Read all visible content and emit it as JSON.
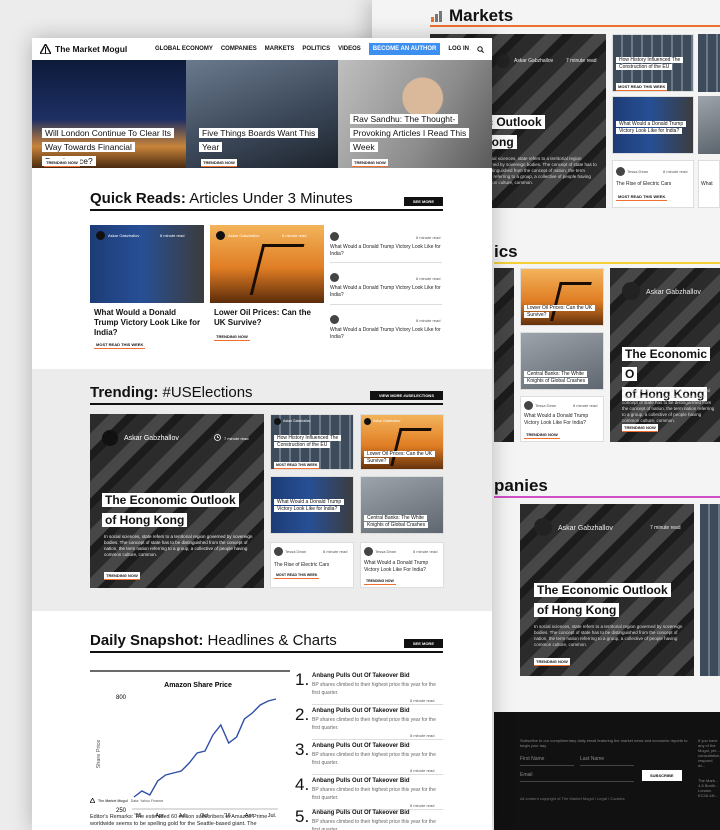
{
  "back": {
    "section_markets": "Markets",
    "section_politics_tail": "ics",
    "section_companies_tail": "panies",
    "rule_colors": [
      "#ef6f2e",
      "#f2d036",
      "#d04fc7"
    ],
    "card_a1": {
      "author": "Askar Gabzhallov",
      "read": "7 minute read",
      "tail1": "ic Outlook",
      "tail2": "Kong",
      "desc": "In social sciences, state refers to a territorial region governed by sovereign bodies. The concept of state has to be distinguished from the concept of nation, the term nation referring to a group, a collective of people having common culture, common."
    },
    "history": "How History Influenced The Construction of the EU",
    "history_trend": "MOST READ THIS WEEK",
    "trump_small": "What Would a Donald Trump Victory Look Like for India?",
    "rise": "The Rise of Electric Cars",
    "rise_author": "Tessa Dean",
    "rise_read": "8 minute read",
    "rise_trend": "MOST READ THIS WEEK",
    "what_tail": "What",
    "oil": "Lower Oil Prices: Can the UK Survive?",
    "crashes": "Central Banks: The White Knights of Global Crashes",
    "trump_author": "Tessa Dean",
    "trump_read": "8 minute read",
    "trump_title": "What Would a Donald Trump Victory Look Like For India?",
    "trump_trend": "TRENDING NOW",
    "big_author": "Askar Gabzhallov",
    "big_title1": "The Economic O",
    "big_title2": "of Hong Kong",
    "big_desc": "In social sciences, state refers to a territorial region governed by sovereign bodies. The concept of state has to be distinguished from the concept of nation, the term nation referring to a group, a collective of people having common culture, common.",
    "big_trend": "TRENDING NOW",
    "comp_author": "Askar Gabzhallov",
    "comp_read": "7 minute read",
    "comp_title1": "The Economic Outlook",
    "comp_title2": "of Hong Kong",
    "comp_desc": "In social sciences, state refers to a territorial region governed by sovereign bodies. The concept of state has to be distinguished from the concept of nation, the term nation referring to a group, a collective of people having common culture, common.",
    "comp_trend": "TRENDING NOW",
    "footer_sub": "Subscribe to our complimentary daily email featuring the market news and economic reports to begin your day",
    "first_name": "First Name",
    "last_name": "Last Name",
    "email": "Email",
    "subscribe": "SUBSCRIBE",
    "copyright": "All content copyright of The Market Mogul / Legal / Cookies",
    "side_note": "If you have any of the Mogul, ple... consultation, respond wi...",
    "address": "The Mark... 4-5 Bonhi... London EC2A 4N..."
  },
  "nav": {
    "logo": "The Market Mogul",
    "items": [
      "GLOBAL ECONOMY",
      "COMPANIES",
      "MARKETS",
      "POLITICS",
      "VIDEOS"
    ],
    "cta": "BECOME AN AUTHOR",
    "login": "LOG IN"
  },
  "hero": [
    {
      "title": "Will London Continue To Clear Its Way Towards Financial Dominance?",
      "tag": "TRENDING NOW"
    },
    {
      "title": "Five Things Boards Want This Year",
      "tag": "TRENDING NOW"
    },
    {
      "title": "Rav Sandhu: The Thought-Provoking Articles I Read This Week",
      "tag": "TRENDING NOW"
    }
  ],
  "quick": {
    "bold": "Quick Reads:",
    "rest": " Articles Under 3 Minutes",
    "button": "SEE MORE",
    "card1": {
      "author": "Askar Gabzhallov",
      "read": "8 minute read",
      "title": "What Would a Donald Trump Victory Look Like for India?",
      "tag": "MOST READ THIS WEEK"
    },
    "card2": {
      "author": "Askar Gabzhallov",
      "read": "8 minute read",
      "title": "Lower Oil Prices: Can the UK Survive?",
      "tag": "TRENDING NOW"
    },
    "list": [
      {
        "read": "8 minute read",
        "title": "What Would a Donald Trump Victory Look Like for India?"
      },
      {
        "read": "8 minute read",
        "title": "What Would a Donald Trump Victory Look Like for India?"
      },
      {
        "read": "8 minute read",
        "title": "What Would a Donald Trump Victory Look Like for India?"
      }
    ]
  },
  "trending": {
    "bold": "Trending:",
    "rest": " #USElections",
    "button": "VIEW MORE #USELECTIONS",
    "big": {
      "author": "Askar Gabzhallov",
      "read": "7 minute read",
      "title1": "The Economic Outlook",
      "title2": "of Hong Kong",
      "desc": "In social sciences, state refers to a territorial region governed by sovereign bodies. The concept of state has to be distinguished from the concept of nation, the term nation referring to a group, a collective of people having common culture, common.",
      "tag": "TRENDING NOW"
    },
    "s1": {
      "author": "Askar Gabzhallov",
      "title": "How History Influenced The Construction of the EU",
      "tag": "MOST READ THIS WEEK"
    },
    "s2": {
      "author": "Askar Gabzhallov",
      "title": "Lower Oil Prices: Can the UK Survive?"
    },
    "s3": {
      "title": "What Would a Donald Trump Victory Look Like for India?"
    },
    "s4": {
      "title": "Central Banks: The White Knights of Global Crashes"
    },
    "b1": {
      "author": "Tessa Dean",
      "read": "8 minute read",
      "title": "The Rise of Electric Cars",
      "tag": "MOST READ THIS WEEK"
    },
    "b2": {
      "author": "Tessa Dean",
      "read": "8 minute read",
      "title": "What Would a Donald Trump Victory Look Like For India?",
      "tag": "TRENDING NOW"
    }
  },
  "snapshot": {
    "bold": "Daily Snapshot:",
    "rest": " Headlines & Charts",
    "button": "SEE MORE",
    "credit_logo": "The Market Mogul",
    "credit_source": "Data: Yahoo Finance",
    "remarks": "Editor's Remarks: The estimated 60 million subscribers to Amazon Prime worldwide seems to be spelling gold for the Seattle-based giant. The",
    "items": [
      {
        "num": "1.",
        "title": "Anbang Pulls Out Of Takeover Bid",
        "desc": "BP shares climbed to their highest price this year for the first quarter.",
        "read": "8 minute read"
      },
      {
        "num": "2.",
        "title": "Anbang Pulls Out Of Takeover Bid",
        "desc": "BP shares climbed to their highest price this year for the first quarter.",
        "read": "8 minute read"
      },
      {
        "num": "3.",
        "title": "Anbang Pulls Out Of Takeover Bid",
        "desc": "BP shares climbed to their highest price this year for the first quarter.",
        "read": "8 minute read"
      },
      {
        "num": "4.",
        "title": "Anbang Pulls Out Of Takeover Bid",
        "desc": "BP shares climbed to their highest price this year for the first quarter.",
        "read": "8 minute read"
      },
      {
        "num": "5.",
        "title": "Anbang Pulls Out Of Takeover Bid",
        "desc": "BP shares climbed to their highest price this year for the first quarter.",
        "read": "8 minute read"
      }
    ]
  },
  "chart_data": {
    "type": "line",
    "title": "Amazon Share Price",
    "xlabel": "",
    "ylabel": "Share Price",
    "ylim": [
      250,
      800
    ],
    "yticks": [
      "800",
      "250"
    ],
    "xticks": [
      "'15",
      "Apr.",
      "Jul.",
      "Oct.",
      "'16",
      "Apr.",
      "Jul."
    ],
    "x": [
      0,
      1,
      2,
      3,
      4,
      5,
      6,
      7,
      8,
      9,
      10,
      11,
      12,
      13,
      14,
      15,
      16,
      17,
      18
    ],
    "series": [
      {
        "values": [
          300,
          330,
          310,
          380,
          410,
          420,
          430,
          470,
          520,
          530,
          610,
          660,
          570,
          600,
          690,
          720,
          760,
          780,
          790
        ],
        "color": "#2f4ea8"
      }
    ]
  }
}
